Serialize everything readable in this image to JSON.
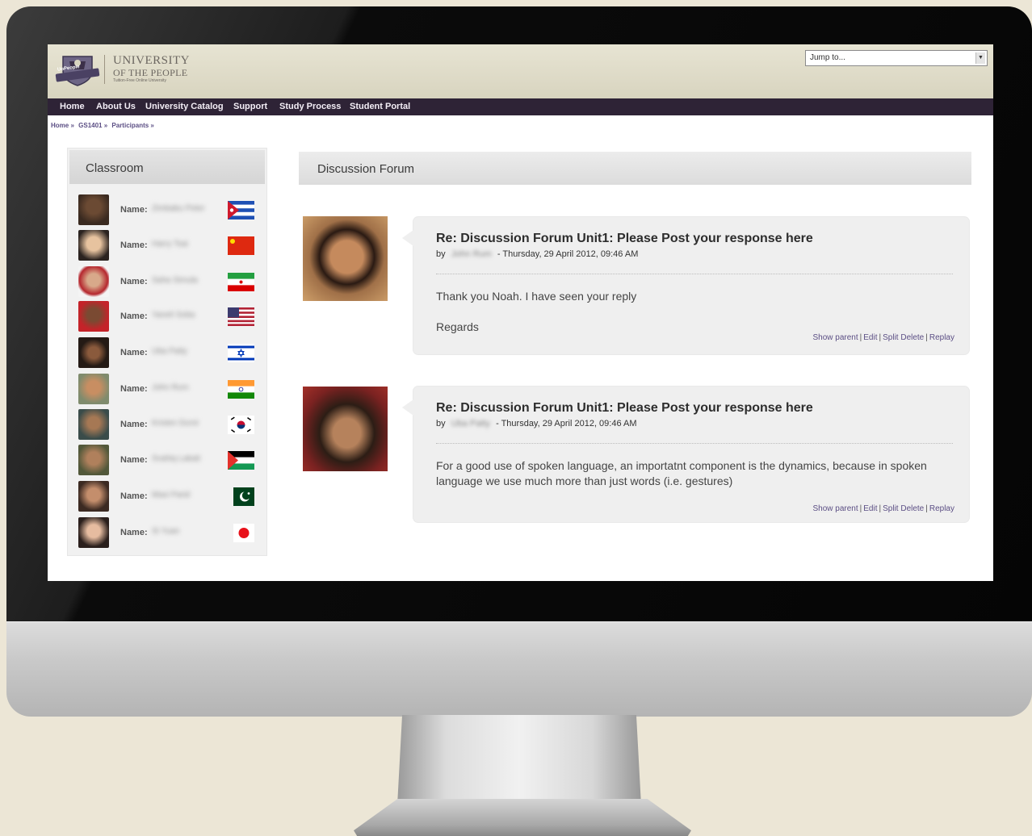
{
  "header": {
    "logo_line1": "UNIVERSITY",
    "logo_line2": "OF THE PEOPLE",
    "logo_tagline": "Tuition-Free Online University",
    "logo_badge": "UoPeople",
    "jump_placeholder": "Jump to..."
  },
  "nav": {
    "items": [
      "Home",
      "About Us",
      "University Catalog",
      "Support",
      "Study Process",
      "Student Portal"
    ]
  },
  "breadcrumb": [
    "Home »",
    "GS1401 »",
    "Participants »"
  ],
  "classroom": {
    "title": "Classroom",
    "name_label": "Name:",
    "participants": [
      {
        "name": "Zimbabu Peter",
        "flag": "cuba"
      },
      {
        "name": "Harry Tsai",
        "flag": "china"
      },
      {
        "name": "Saha Simula",
        "flag": "iran"
      },
      {
        "name": "Yaneli Soba",
        "flag": "usa"
      },
      {
        "name": "Uba Patty",
        "flag": "israel"
      },
      {
        "name": "John Rum",
        "flag": "india"
      },
      {
        "name": "Kristen Durst",
        "flag": "south-korea"
      },
      {
        "name": "Svahiq Lakati",
        "flag": "palestine"
      },
      {
        "name": "Maxi Parid",
        "flag": "pakistan"
      },
      {
        "name": "Si Yuan",
        "flag": "japan"
      }
    ]
  },
  "forum": {
    "title": "Discussion Forum",
    "posts": [
      {
        "subject": "Re: Discussion Forum Unit1: Please Post your response here",
        "by_label": "by",
        "author": "John Rum",
        "date": "- Thursday, 29 April 2012, 09:46 AM",
        "body_line1": "Thank you Noah. I have seen your reply",
        "body_line2": "Regards",
        "actions": [
          "Show parent",
          "Edit",
          "Split Delete",
          "Replay"
        ]
      },
      {
        "subject": "Re: Discussion Forum Unit1: Please Post your response here",
        "by_label": "by",
        "author": "Uba Patty",
        "date": "- Thursday, 29 April 2012, 09:46 AM",
        "body_line1": "For a good use of spoken language, an importatnt component is the dynamics, because in spoken language we use much more than just words (i.e. gestures)",
        "actions": [
          "Show parent",
          "Edit",
          "Split Delete",
          "Replay"
        ]
      }
    ]
  },
  "colors": {
    "nav_bg": "#2e2336",
    "link": "#5b4e84",
    "header_bg": "#e7e4d3"
  }
}
